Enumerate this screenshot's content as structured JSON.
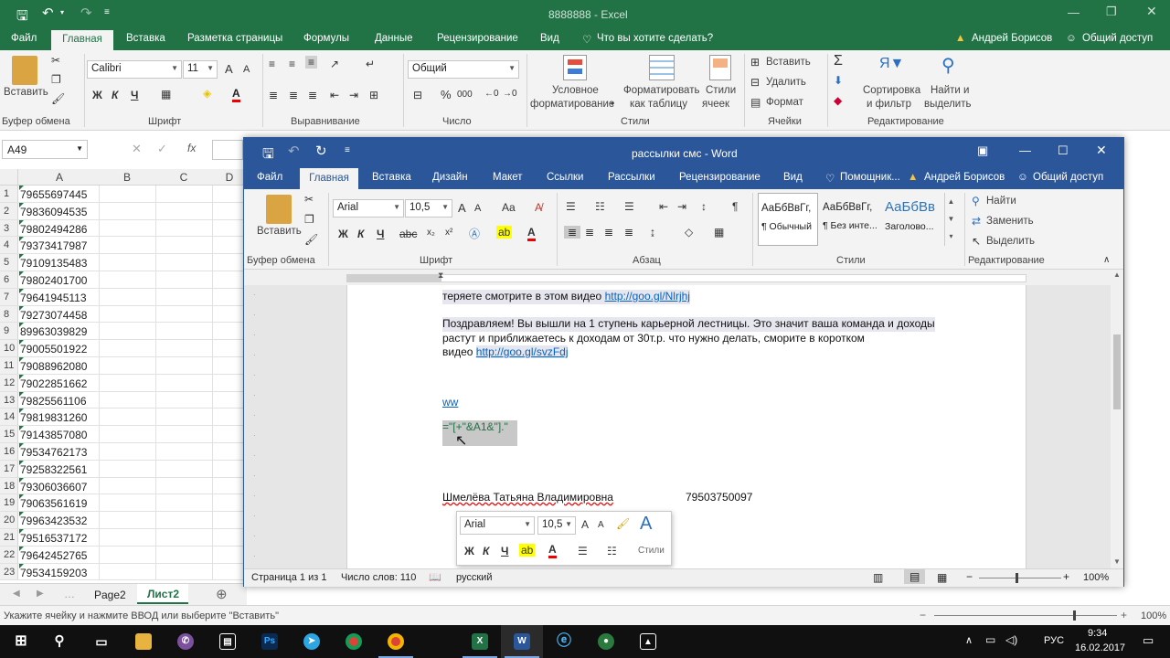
{
  "excel": {
    "title": "8888888 - Excel",
    "tabs": [
      "Файл",
      "Главная",
      "Вставка",
      "Разметка страницы",
      "Формулы",
      "Данные",
      "Рецензирование",
      "Вид"
    ],
    "tell_me": "Что вы хотите сделать?",
    "user": "Андрей Борисов",
    "share": "Общий доступ",
    "clipboard": {
      "paste": "Вставить",
      "group": "Буфер обмена"
    },
    "font": {
      "name": "Calibri",
      "size": "11",
      "group": "Шрифт",
      "bold": "Ж",
      "italic": "К",
      "underline": "Ч",
      "grow": "A",
      "shrink": "A",
      "color_a": "A"
    },
    "alignment": {
      "group": "Выравнивание"
    },
    "number": {
      "format": "Общий",
      "group": "Число",
      "percent": "%",
      "thousands": "000"
    },
    "styles": {
      "conditional": "Условное",
      "conditional2": "форматирование",
      "as_table": "Форматировать",
      "as_table2": "как таблицу",
      "cell_styles": "Стили",
      "cell_styles2": "ячеек",
      "group": "Стили"
    },
    "cells": {
      "insert": "Вставить",
      "delete": "Удалить",
      "format": "Формат",
      "group": "Ячейки"
    },
    "editing": {
      "sort": "Сортировка",
      "sort2": "и фильтр",
      "find": "Найти и",
      "find2": "выделить",
      "group": "Редактирование"
    },
    "name_box": "A49",
    "columns": [
      "A",
      "B",
      "C",
      "D"
    ],
    "rows": [
      {
        "n": "1",
        "v": "79655697445"
      },
      {
        "n": "2",
        "v": "79836094535"
      },
      {
        "n": "3",
        "v": "79802494286"
      },
      {
        "n": "4",
        "v": "79373417987"
      },
      {
        "n": "5",
        "v": "79109135483"
      },
      {
        "n": "6",
        "v": "79802401700"
      },
      {
        "n": "7",
        "v": "79641945113"
      },
      {
        "n": "8",
        "v": "79273074458"
      },
      {
        "n": "9",
        "v": "89963039829"
      },
      {
        "n": "10",
        "v": "79005501922"
      },
      {
        "n": "11",
        "v": "79088962080"
      },
      {
        "n": "12",
        "v": "79022851662"
      },
      {
        "n": "13",
        "v": "79825561106"
      },
      {
        "n": "14",
        "v": "79819831260"
      },
      {
        "n": "15",
        "v": "79143857080"
      },
      {
        "n": "16",
        "v": "79534762173"
      },
      {
        "n": "17",
        "v": "79258322561"
      },
      {
        "n": "18",
        "v": "79306036607"
      },
      {
        "n": "19",
        "v": "79063561619"
      },
      {
        "n": "20",
        "v": "79963423532"
      },
      {
        "n": "21",
        "v": "79516537172"
      },
      {
        "n": "22",
        "v": "79642452765"
      },
      {
        "n": "23",
        "v": "79534159203"
      }
    ],
    "sheets": [
      "Page2",
      "Лист2"
    ],
    "status_text": "Укажите ячейку и нажмите ВВОД или выберите \"Вставить\"",
    "zoom": "100%"
  },
  "word": {
    "title": "рассылки смс - Word",
    "tabs": [
      "Файл",
      "Главная",
      "Вставка",
      "Дизайн",
      "Макет",
      "Ссылки",
      "Рассылки",
      "Рецензирование",
      "Вид"
    ],
    "tell_me": "Помощник...",
    "user": "Андрей Борисов",
    "share": "Общий доступ",
    "clipboard": {
      "paste": "Вставить",
      "group": "Буфер обмена"
    },
    "font": {
      "name": "Arial",
      "size": "10,5",
      "group": "Шрифт",
      "bold": "Ж",
      "italic": "К",
      "underline": "Ч",
      "case": "Aa"
    },
    "paragraph": {
      "group": "Абзац"
    },
    "styles": {
      "items": [
        {
          "sample": "АаБбВвГг,",
          "name": "¶ Обычный"
        },
        {
          "sample": "АаБбВвГг,",
          "name": "¶ Без инте..."
        },
        {
          "sample": "АаБбВв",
          "name": "Заголово..."
        }
      ],
      "group": "Стили"
    },
    "editing": {
      "find": "Найти",
      "replace": "Заменить",
      "select": "Выделить",
      "group": "Редактирование"
    },
    "doc": {
      "line_top": "теряете смотрите в этом видео ",
      "link1": "http://goo.gl/Nlrjhj",
      "para2_l1": "Поздравляем! Вы вышли на 1 ступень карьерной лестницы. Это значит ваша команда и доходы",
      "para2_l2": "растут и приближаетесь к доходам от 30т.р. что нужно делать, сморите в коротком",
      "para2_l3": "видео ",
      "link2": "http://goo.gl/svzFdj",
      "ww": "ww",
      "formula": "=\"[+\"&A1&\"].\"",
      "signature_name": "Шмелёва Татьяна Владимировна",
      "signature_phone": "79503750097"
    },
    "minitoolbar": {
      "font": "Arial",
      "size": "10,5",
      "styles": "Стили"
    },
    "status": {
      "page": "Страница 1 из 1",
      "words": "Число слов: 110",
      "lang": "русский",
      "zoom": "100%"
    }
  },
  "taskbar": {
    "lang": "РУС",
    "time": "9:34",
    "date": "16.02.2017"
  }
}
